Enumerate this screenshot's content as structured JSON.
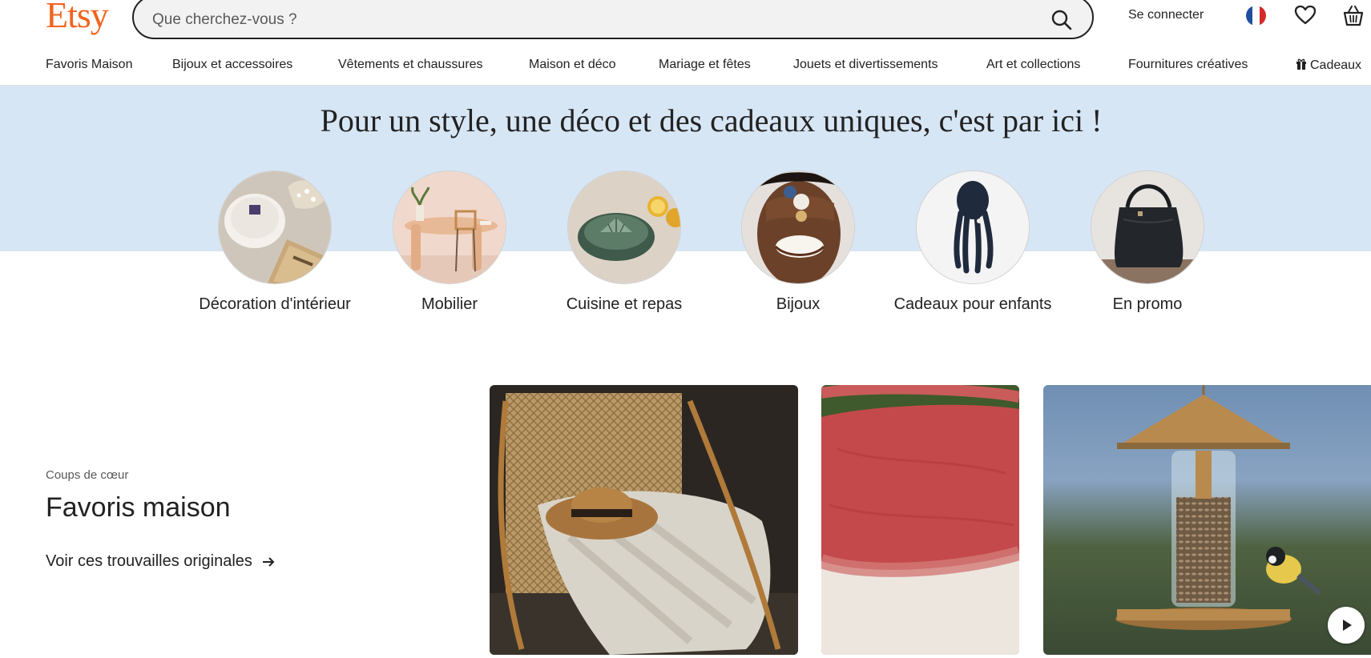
{
  "header": {
    "logo": "Etsy",
    "search_placeholder": "Que cherchez-vous ?",
    "signin_label": "Se connecter",
    "icons": [
      "search-icon",
      "france-flag-icon",
      "heart-icon",
      "basket-icon"
    ]
  },
  "nav": {
    "items": [
      "Favoris Maison",
      "Bijoux et accessoires",
      "Vêtements et chaussures",
      "Maison et déco",
      "Mariage et fêtes",
      "Jouets et divertissements",
      "Art et collections",
      "Fournitures créatives",
      "Cadeaux"
    ]
  },
  "hero": {
    "title": "Pour un style, une déco et des cadeaux uniques, c'est par ici !",
    "categories": [
      {
        "label": "Décoration d'intérieur"
      },
      {
        "label": "Mobilier"
      },
      {
        "label": "Cuisine et repas"
      },
      {
        "label": "Bijoux"
      },
      {
        "label": "Cadeaux pour enfants"
      },
      {
        "label": "En promo"
      }
    ]
  },
  "featured": {
    "eyebrow": "Coups de cœur",
    "title": "Favoris maison",
    "link_label": "Voir ces trouvailles originales"
  },
  "colors": {
    "brand": "#f1641e",
    "hero_bg": "#d7e6f5",
    "text": "#222222"
  }
}
